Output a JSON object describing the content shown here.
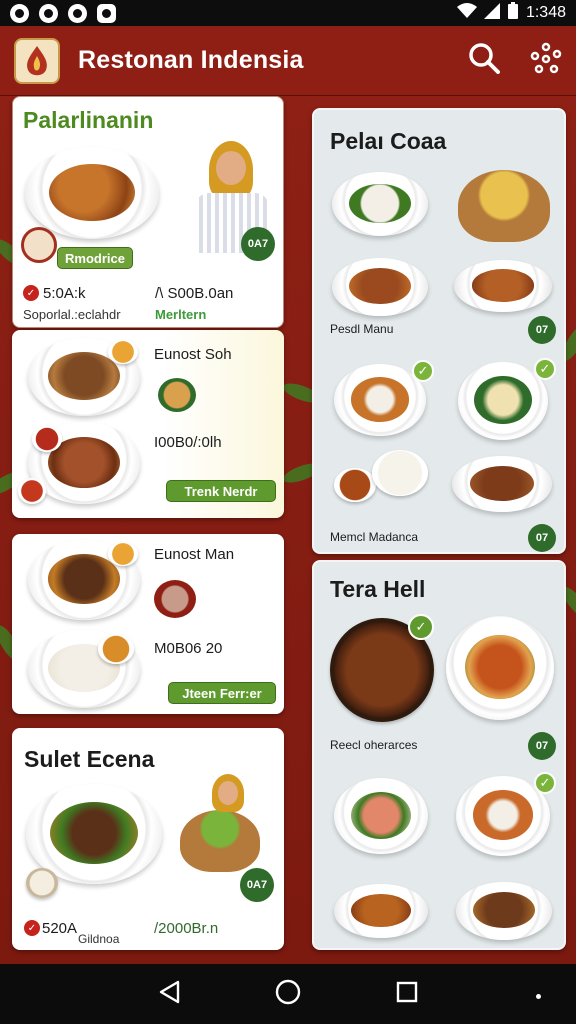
{
  "status_bar": {
    "time": "1:348"
  },
  "app_bar": {
    "title": "Restonan Indensia"
  },
  "colors": {
    "brand_red": "#8f1f14",
    "accent_green": "#5f9a2e",
    "badge_green": "#2f6b2a"
  },
  "cards": {
    "card1": {
      "title": "Palarlinanin",
      "pill": "Rmodrice",
      "badge": "0A7",
      "price_left": "5:0A:k",
      "desc_left": "Soporlal.:eclahdr",
      "price_right": "/\\ S00B.0an",
      "desc_right": "Merltern"
    },
    "card2": {
      "title": "Eunost Soh",
      "price": "I00B0/:0lh",
      "button": "Trenk Nerdr"
    },
    "card3": {
      "title": "Eunost Man",
      "price": "M0B06 20",
      "button": "Jteen Ferr:er"
    },
    "card4": {
      "title": "Sulet Ecena",
      "badge": "0A7",
      "price_left": "520A",
      "desc_left": "Gildnoa",
      "price_right": "/2000Br.n"
    }
  },
  "right": {
    "panel1": {
      "title": "Pelaı Coaa",
      "label1": "Pesdl Manu",
      "label2": "Memcl Madanca",
      "badge": "07"
    },
    "panel2": {
      "title": "Tera Hell",
      "label1": "Reecl oherarces",
      "badge": "07"
    }
  },
  "icons": [
    "search-icon",
    "share-icon",
    "back-icon",
    "home-icon",
    "recents-icon",
    "wifi-icon",
    "signal-icon",
    "battery-icon",
    "check-icon"
  ]
}
